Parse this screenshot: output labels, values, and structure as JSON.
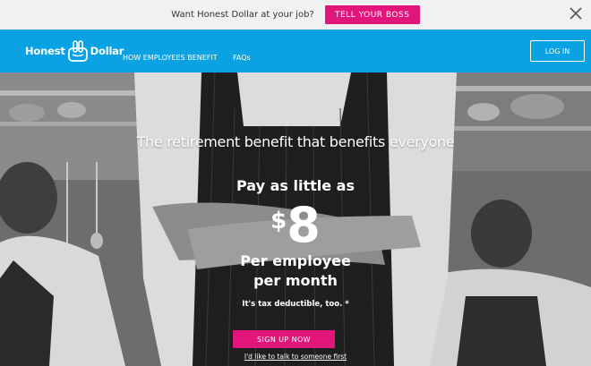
{
  "announcement": {
    "message": "Want Honest Dollar at your job?",
    "cta_label": "TELL YOUR BOSS"
  },
  "nav": {
    "logo_left": "Honest",
    "logo_right": "Dollar",
    "links": [
      "HOW EMPLOYEES BENEFIT",
      "FAQs"
    ],
    "login_label": "LOG IN"
  },
  "hero": {
    "tagline": "The retirement benefit that benefits everyone",
    "pay_line": "Pay as little as",
    "currency": "$",
    "amount": "8",
    "per_line1": "Per employee",
    "per_line2": "per month",
    "tax_note": "It's tax deductible, too. *",
    "signup_label": "SIGN UP NOW",
    "talk_link": "I'd like to talk to someone first"
  },
  "colors": {
    "brand_blue": "#0aa2e2",
    "accent_pink": "#e2167a"
  },
  "icons": {
    "close": "close-icon",
    "logo": "peace-hand-logo-icon"
  }
}
